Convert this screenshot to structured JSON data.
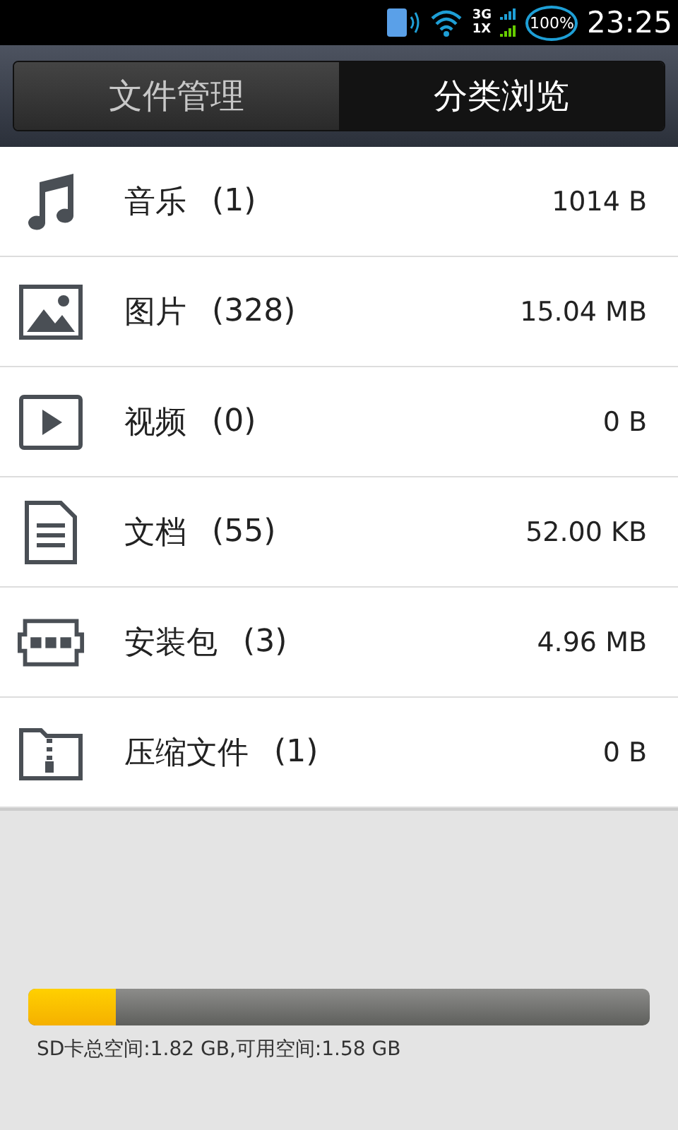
{
  "status_bar": {
    "network_top": "3G",
    "network_bottom": "1X",
    "battery": "100%",
    "time": "23:25"
  },
  "tabs": [
    {
      "label": "文件管理",
      "selected": false
    },
    {
      "label": "分类浏览",
      "selected": true
    }
  ],
  "categories": [
    {
      "kind": "music",
      "name": "音乐",
      "count": "(1)",
      "size": "1014 B"
    },
    {
      "kind": "image",
      "name": "图片",
      "count": "(328)",
      "size": "15.04 MB"
    },
    {
      "kind": "video",
      "name": "视频",
      "count": "(0)",
      "size": "0 B"
    },
    {
      "kind": "document",
      "name": "文档",
      "count": "(55)",
      "size": "52.00 KB"
    },
    {
      "kind": "apk",
      "name": "安装包",
      "count": "(3)",
      "size": "4.96 MB"
    },
    {
      "kind": "archive",
      "name": "压缩文件",
      "count": "(1)",
      "size": "0 B"
    }
  ],
  "storage": {
    "level": 0.14,
    "label": "SD卡总空间:1.82 GB,可用空间:1.58 GB"
  }
}
